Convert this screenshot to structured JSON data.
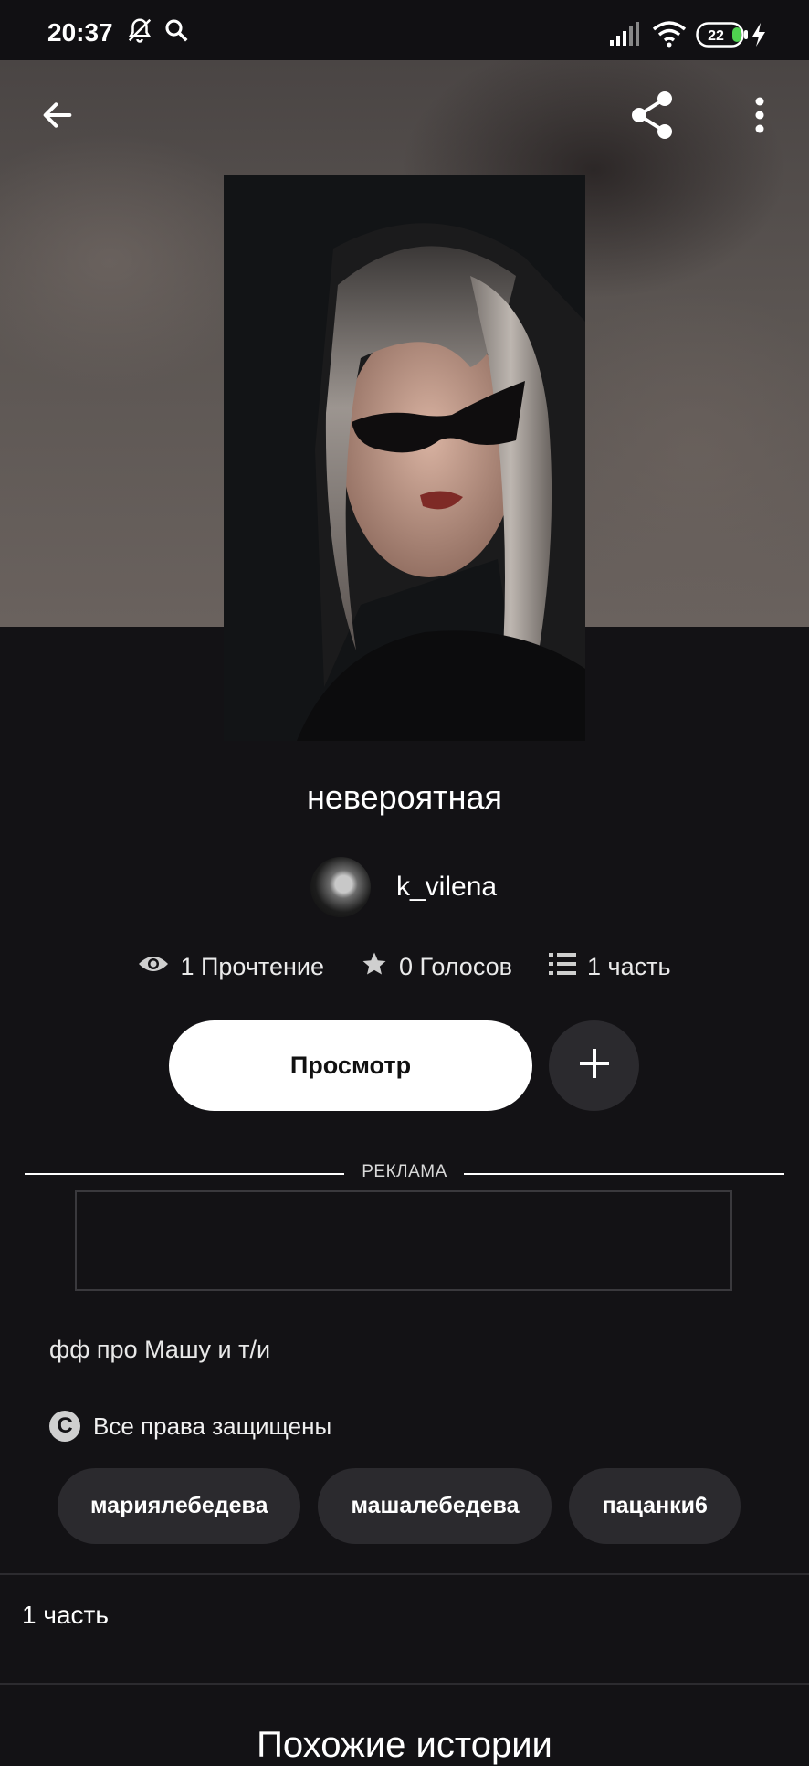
{
  "status_bar": {
    "time": "20:37",
    "battery": "22",
    "icons": [
      "bell-off-icon",
      "search-icon",
      "signal-icon",
      "wifi-icon",
      "battery-icon",
      "charging-icon"
    ]
  },
  "toolbar": {
    "back_icon": "arrow-left-icon",
    "share_icon": "share-icon",
    "more_icon": "more-vertical-icon"
  },
  "story": {
    "title": "невероятная",
    "author": "k_vilena",
    "stats": {
      "reads": "1 Прочтение",
      "votes": "0 Голосов",
      "parts": "1 часть"
    },
    "read_button": "Просмотр",
    "description": "фф про Машу и т/и",
    "copyright": "Все права защищены",
    "tags": [
      "мариялебедева",
      "машалебедева",
      "пацанки6"
    ]
  },
  "ad": {
    "label": "РЕКЛАМА"
  },
  "parts_section": {
    "label": "1 часть"
  },
  "similar_section": {
    "title": "Похожие истории"
  },
  "colors": {
    "background": "#131215",
    "button_primary": "#ffffff",
    "chip": "#2b2a2e"
  }
}
